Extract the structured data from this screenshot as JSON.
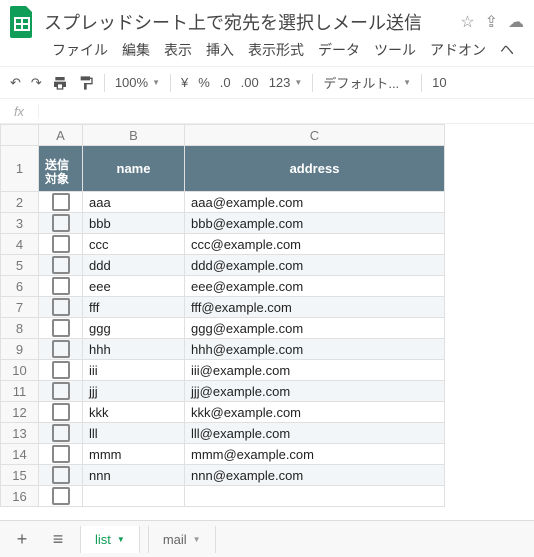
{
  "doc": {
    "title": "スプレッドシート上で宛先を選択しメール送信"
  },
  "menu": {
    "file": "ファイル",
    "edit": "編集",
    "view": "表示",
    "insert": "挿入",
    "format": "表示形式",
    "data": "データ",
    "tools": "ツール",
    "addons": "アドオン",
    "help": "ヘ"
  },
  "toolbar": {
    "zoom": "100%",
    "yen": "¥",
    "percent": "%",
    "dec_dec": ".0",
    "inc_dec": ".00",
    "numfmt": "123",
    "font": "デフォルト...",
    "fontsize": "10"
  },
  "fx": {
    "label": "fx"
  },
  "columns": {
    "a": "A",
    "b": "B",
    "c": "C"
  },
  "headers": {
    "target": "送信\n対象",
    "name": "name",
    "address": "address"
  },
  "rows": [
    {
      "n": "1"
    },
    {
      "n": "2",
      "name": "aaa",
      "addr": "aaa@example.com"
    },
    {
      "n": "3",
      "name": "bbb",
      "addr": "bbb@example.com"
    },
    {
      "n": "4",
      "name": "ccc",
      "addr": "ccc@example.com"
    },
    {
      "n": "5",
      "name": "ddd",
      "addr": "ddd@example.com"
    },
    {
      "n": "6",
      "name": "eee",
      "addr": "eee@example.com"
    },
    {
      "n": "7",
      "name": "fff",
      "addr": "fff@example.com"
    },
    {
      "n": "8",
      "name": "ggg",
      "addr": "ggg@example.com"
    },
    {
      "n": "9",
      "name": "hhh",
      "addr": "hhh@example.com"
    },
    {
      "n": "10",
      "name": "iii",
      "addr": "iii@example.com"
    },
    {
      "n": "11",
      "name": "jjj",
      "addr": "jjj@example.com"
    },
    {
      "n": "12",
      "name": "kkk",
      "addr": "kkk@example.com"
    },
    {
      "n": "13",
      "name": "lll",
      "addr": "lll@example.com"
    },
    {
      "n": "14",
      "name": "mmm",
      "addr": "mmm@example.com"
    },
    {
      "n": "15",
      "name": "nnn",
      "addr": "nnn@example.com"
    },
    {
      "n": "16"
    }
  ],
  "tabs": {
    "active": "list",
    "inactive": "mail"
  }
}
